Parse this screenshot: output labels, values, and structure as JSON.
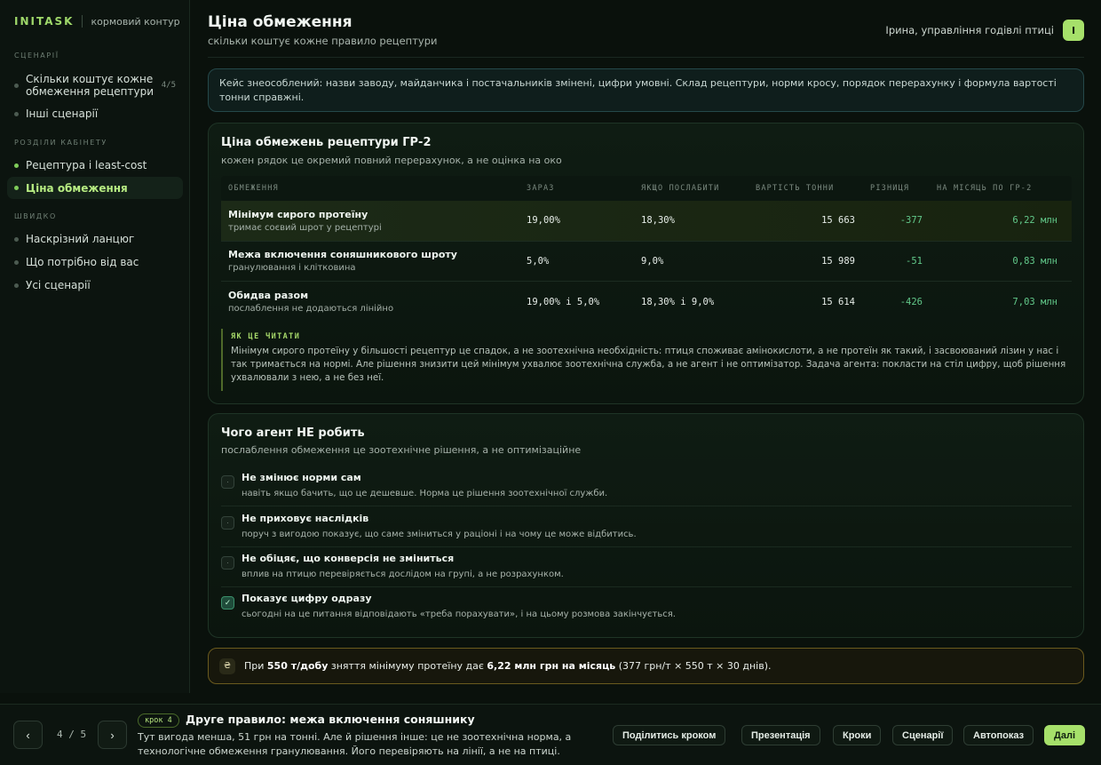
{
  "app": {
    "brand": "INITASK",
    "context": "кормовий контур"
  },
  "sidebar": {
    "sections": [
      {
        "title": "СЦЕНАРІЇ"
      },
      {
        "title": "РОЗДІЛИ КАБІНЕТУ"
      },
      {
        "title": "ШВИДКО"
      }
    ],
    "scenarios": [
      {
        "label": "Скільки коштує кожне обмеження рецептури",
        "count": "4/5"
      },
      {
        "label": "Інші сценарії"
      }
    ],
    "cabinet": [
      {
        "label": "Рецептура і least-cost"
      },
      {
        "label": "Ціна обмеження"
      }
    ],
    "quick": [
      {
        "label": "Наскрізний ланцюг"
      },
      {
        "label": "Що потрібно від вас"
      },
      {
        "label": "Усі сценарії"
      }
    ]
  },
  "header": {
    "title": "Ціна обмеження",
    "subtitle": "скільки коштує кожне правило рецептури",
    "user_name": "Ірина, управління годівлі птиці",
    "avatar_letter": "І"
  },
  "notice": "Кейс знеособлений: назви заводу, майданчика і постачальників змінені, цифри умовні. Склад рецептури, норми кросу, порядок перерахунку і формула вартості тонни справжні.",
  "constraints_card": {
    "title": "Ціна обмежень рецептури ГР-2",
    "subtitle": "кожен рядок це окремий повний перерахунок, а не оцінка на око",
    "columns": [
      "ОБМЕЖЕННЯ",
      "ЗАРАЗ",
      "ЯКЩО ПОСЛАБИТИ",
      "ВАРТІСТЬ ТОННИ",
      "РІЗНИЦЯ",
      "НА МІСЯЦЬ ПО ГР-2"
    ],
    "rows": [
      {
        "name": "Мінімум сирого протеїну",
        "desc": "тримає соєвий шрот у рецептурі",
        "now": "19,00%",
        "relaxed": "18,30%",
        "ton_cost": "15 663",
        "diff": "-377",
        "monthly": "6,22 млн"
      },
      {
        "name": "Межа включення соняшникового шроту",
        "desc": "гранулювання і клітковина",
        "now": "5,0%",
        "relaxed": "9,0%",
        "ton_cost": "15 989",
        "diff": "-51",
        "monthly": "0,83 млн"
      },
      {
        "name": "Обидва разом",
        "desc": "послаблення не додаються лінійно",
        "now": "19,00% і 5,0%",
        "relaxed": "18,30% і 9,0%",
        "ton_cost": "15 614",
        "diff": "-426",
        "monthly": "7,03 млн"
      }
    ],
    "explain_title": "ЯК ЦЕ ЧИТАТИ",
    "explain_text": "Мінімум сирого протеїну у більшості рецептур це спадок, а не зоотехнічна необхідність: птиця споживає амінокислоти, а не протеїн як такий, і засвоюваний лізин у нас і так тримається на нормі. Але рішення знизити цей мінімум ухвалює зоотехнічна служба, а не агент і не оптимізатор. Задача агента: покласти на стіл цифру, щоб рішення ухвалювали з нею, а не без неї."
  },
  "agent_card": {
    "title": "Чого агент НЕ робить",
    "subtitle": "послаблення обмеження це зоотехнічне рішення, а не оптимізаційне",
    "items": [
      {
        "title": "Не змінює норми сам",
        "desc": "навіть якщо бачить, що це дешевше. Норма це рішення зоотехнічної служби.",
        "mark": "·"
      },
      {
        "title": "Не приховує наслідків",
        "desc": "поруч з вигодою показує, що саме зміниться у раціоні і на чому це може відбитись.",
        "mark": "·"
      },
      {
        "title": "Не обіцяє, що конверсія не зміниться",
        "desc": "вплив на птицю перевіряється дослідом на групі, а не розрахунком.",
        "mark": "·"
      },
      {
        "title": "Показує цифру одразу",
        "desc": "сьогодні на це питання відповідають «треба порахувати», і на цьому розмова закінчується.",
        "mark": "✓"
      }
    ]
  },
  "summary": {
    "icon": "₴",
    "p1": "При ",
    "b1": "550 т/добу",
    "p2": " зняття мінімуму протеїну дає ",
    "b2": "6,22 млн грн на місяць",
    "p3": " (377 грн/т × 550 т × 30 днів)."
  },
  "footer": {
    "prev": "‹",
    "next": "›",
    "pager": "4 / 5",
    "step_badge": "крок 4",
    "step_title": "Друге правило: межа включення соняшнику",
    "step_desc": "Тут вигода менша, 51 грн на тонні. Але й рішення інше: це не зоотехнічна норма, а технологічне обмеження гранулювання. Його перевіряють на лінії, а не на птиці.",
    "buttons": [
      "Поділитись кроком",
      "Презентація",
      "Кроки",
      "Сценарії",
      "Автопоказ",
      "Далі"
    ]
  },
  "colors": {
    "accent": "#a6e06a",
    "positive": "#62c98a",
    "background": "#0a110c"
  }
}
